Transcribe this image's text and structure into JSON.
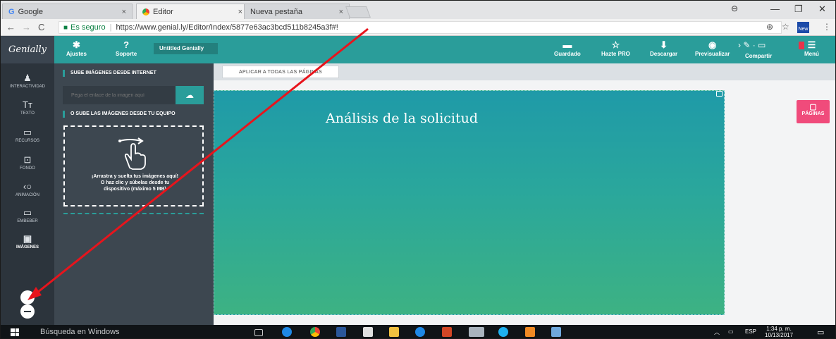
{
  "browser": {
    "tabs": [
      {
        "label": "Google",
        "close": "×"
      },
      {
        "label": "Editor",
        "close": "×"
      },
      {
        "label": "Nueva pestaña",
        "close": "×"
      }
    ],
    "window_controls": {
      "min": "—",
      "max": "❐",
      "close": "✕"
    },
    "secure_label": "Es seguro",
    "url": "https://www.genial.ly/Editor/Index/5877e63ac3bcd511b8245a3f#!",
    "ext_badge": "New"
  },
  "app": {
    "logo": "Genially",
    "ajustes": "Ajustes",
    "soporte": "Soporte",
    "title": "Untitled Genially",
    "guardado": "Guardado",
    "hazte_pro": "Hazte PRO",
    "descargar": "Descargar",
    "previsualizar": "Previsualizar",
    "compartir": "Compartir",
    "menu": "Menú"
  },
  "sidebar": {
    "items": [
      {
        "label": "INTERACTIVIDAD",
        "icon": "person-icon"
      },
      {
        "label": "TEXTO",
        "icon": "text-icon"
      },
      {
        "label": "RECURSOS",
        "icon": "resources-icon"
      },
      {
        "label": "FONDO",
        "icon": "background-icon"
      },
      {
        "label": "ANIMACIÓN",
        "icon": "animation-icon"
      },
      {
        "label": "EMBEBER",
        "icon": "embed-icon"
      },
      {
        "label": "IMÁGENES",
        "icon": "images-icon"
      }
    ]
  },
  "panel": {
    "internet_header": "SUBE IMÁGENES DESDE INTERNET",
    "url_placeholder": "Pega el enlace de la imagen aquí",
    "device_header": "O SUBE LAS IMÁGENES DESDE TU EQUIPO",
    "drop_line1": "¡Arrastra y suelta tus imágenes aquí!",
    "drop_line2": "O haz clic y súbelas desde tu",
    "drop_line3": "dispositivo (máximo 5 MB)"
  },
  "canvas": {
    "apply_all": "APLICAR A TODAS LAS PÁGINAS",
    "slide_title": "Análisis de la solicitud",
    "paginas": "PÁGINAS"
  },
  "taskbar": {
    "search": "Búsqueda en Windows",
    "lang": "ESP",
    "time": "1:34 p. m.",
    "date": "10/13/2017"
  }
}
